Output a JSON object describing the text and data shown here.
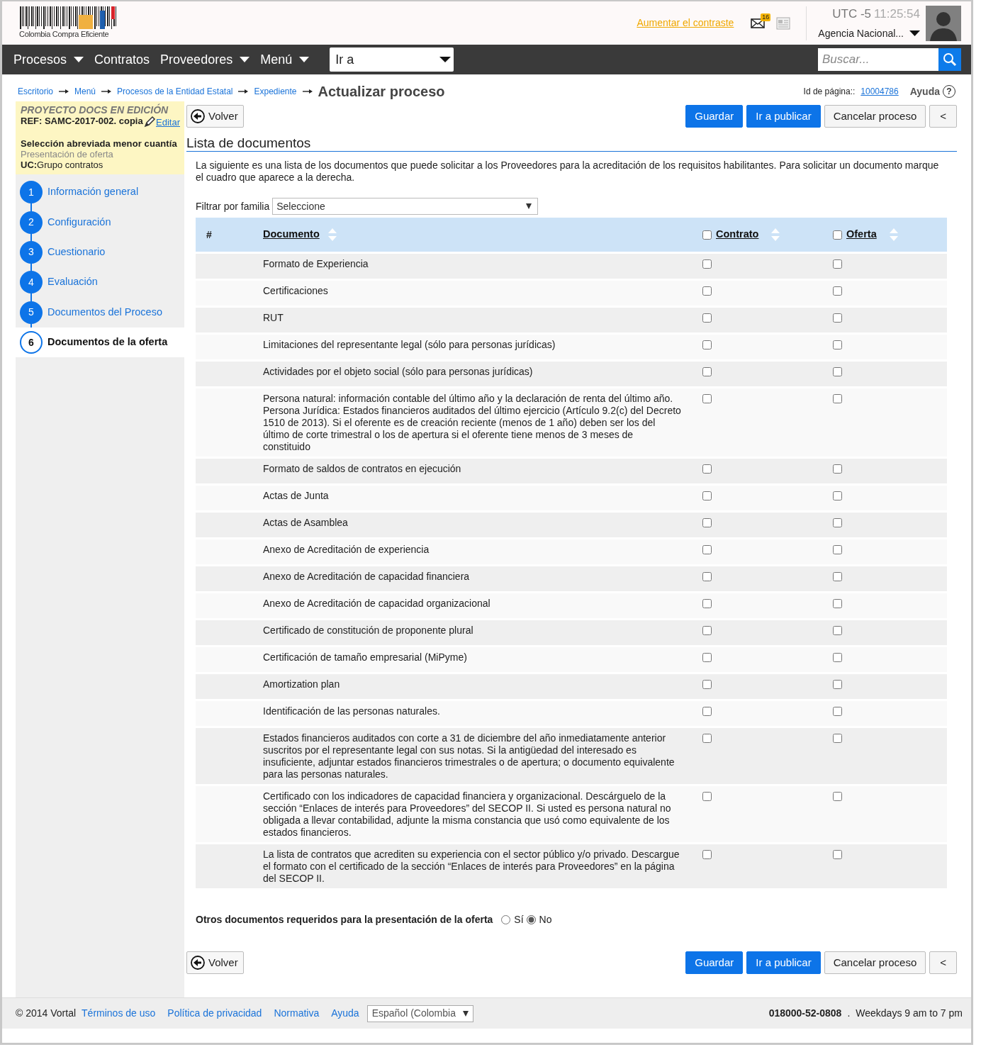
{
  "header": {
    "logo_text": "Colombia Compra Eficiente",
    "contrast_link": "Aumentar el contraste",
    "mail_count": "16",
    "timezone": "UTC -5",
    "time": "11:25:54",
    "agency": "Agencia Nacional..."
  },
  "nav": {
    "items": [
      {
        "label": "Procesos",
        "dropdown": true
      },
      {
        "label": "Contratos",
        "dropdown": false
      },
      {
        "label": "Proveedores",
        "dropdown": true
      },
      {
        "label": "Menú",
        "dropdown": true
      }
    ],
    "goto": "Ir a",
    "search_placeholder": "Buscar..."
  },
  "breadcrumb": {
    "links": [
      "Escritorio",
      "Menú",
      "Procesos de la Entidad Estatal",
      "Expediente"
    ],
    "current": "Actualizar proceso"
  },
  "page_id_label": "Id de página::",
  "page_id": "10004786",
  "help": "Ayuda",
  "help_glyph": "?",
  "sidebar": {
    "status": "PROYECTO DOCS EN EDICIÓN",
    "ref": "REF:  SAMC-2017-002. copia",
    "edit": "Editar",
    "modality": "Selección abreviada menor cuantía",
    "phase": "Presentación de oferta",
    "unit_label": "UC:",
    "unit": "Grupo contratos",
    "steps": [
      {
        "number": "1",
        "label": "Información general",
        "selected": false
      },
      {
        "number": "2",
        "label": "Configuración",
        "selected": false
      },
      {
        "number": "3",
        "label": "Cuestionario",
        "selected": false
      },
      {
        "number": "4",
        "label": "Evaluación",
        "selected": false
      },
      {
        "number": "5",
        "label": "Documentos del Proceso",
        "selected": false
      },
      {
        "number": "6",
        "label": "Documentos de la oferta",
        "selected": true
      }
    ]
  },
  "toolbar_top": {
    "back": "Volver",
    "actions": [
      {
        "label": "Guardar",
        "kind": "primary"
      },
      {
        "label": "Ir a publicar",
        "kind": "primary"
      },
      {
        "label": "Cancelar proceso",
        "kind": "secondary"
      },
      {
        "label": "<",
        "kind": "secondary"
      }
    ]
  },
  "section_title": "Lista de documentos",
  "intro": "La siguiente es una lista de los documentos que puede solicitar a los Proveedores para la acreditación de los requisitos habilitantes. Para solicitar un documento marque el cuadro que aparece a la derecha.",
  "filter": {
    "label": "Filtrar por familia",
    "value": "Seleccione"
  },
  "table": {
    "columns": [
      {
        "label": "#",
        "kind": "plain"
      },
      {
        "label": "Documento",
        "kind": "sort"
      },
      {
        "label": "Contrato",
        "kind": "sort_check",
        "checked": false
      },
      {
        "label": "Oferta",
        "kind": "sort_check",
        "checked": false
      }
    ],
    "rows": [
      {
        "document": "Formato de Experiencia",
        "contrato": false,
        "oferta": false
      },
      {
        "document": "Certificaciones",
        "contrato": false,
        "oferta": false
      },
      {
        "document": "RUT",
        "contrato": false,
        "oferta": false
      },
      {
        "document": "Limitaciones del representante legal (sólo para personas jurídicas)",
        "contrato": false,
        "oferta": false
      },
      {
        "document": "Actividades por el objeto social (sólo para personas jurídicas)",
        "contrato": false,
        "oferta": false
      },
      {
        "document": "Persona natural: información contable del último año y la declaración de renta del último año. Persona Jurídica: Estados financieros auditados del último ejercicio (Artículo 9.2(c) del Decreto 1510 de 2013). Si el oferente es de creación reciente (menos de 1 año) deben ser los del último de corte trimestral o los de apertura si el oferente tiene menos de 3 meses de constituido",
        "contrato": false,
        "oferta": false
      },
      {
        "document": "Formato de saldos de contratos en ejecución",
        "contrato": false,
        "oferta": false
      },
      {
        "document": "Actas de Junta",
        "contrato": false,
        "oferta": false
      },
      {
        "document": "Actas de Asamblea",
        "contrato": false,
        "oferta": false
      },
      {
        "document": "Anexo de Acreditación de experiencia",
        "contrato": false,
        "oferta": false
      },
      {
        "document": "Anexo de Acreditación de capacidad financiera",
        "contrato": false,
        "oferta": false
      },
      {
        "document": "Anexo de Acreditación de capacidad organizacional",
        "contrato": false,
        "oferta": false
      },
      {
        "document": "Certificado de constitución de proponente plural",
        "contrato": false,
        "oferta": false
      },
      {
        "document": "Certificación de tamaño empresarial (MiPyme)",
        "contrato": false,
        "oferta": false
      },
      {
        "document": "Amortization plan",
        "contrato": false,
        "oferta": false
      },
      {
        "document": "Identificación de las personas naturales.",
        "contrato": false,
        "oferta": false
      },
      {
        "document": "Estados financieros auditados con corte a 31 de diciembre del año inmediatamente anterior suscritos por el representante legal con sus notas. Si la antigüedad del interesado es insuficiente, adjuntar estados financieros trimestrales o de apertura; o documento equivalente para las personas naturales.",
        "contrato": false,
        "oferta": false
      },
      {
        "document": "Certificado con los indicadores de capacidad financiera y organizacional. Descárguelo de la sección “Enlaces de interés para Proveedores” del SECOP II. Si usted es persona natural no obligada a llevar contabilidad, adjunte la misma constancia que usó como equivalente de los estados financieros.",
        "contrato": false,
        "oferta": false
      },
      {
        "document": "La lista de contratos que acrediten su experiencia con el sector público y/o privado. Descargue el formato con el certificado de la sección “Enlaces de interés para Proveedores” en la página del SECOP II.",
        "contrato": false,
        "oferta": false
      }
    ]
  },
  "other_docs": {
    "question": "Otros documentos requeridos para la presentación de la oferta",
    "options": [
      {
        "label": "Sí",
        "selected": false
      },
      {
        "label": "No",
        "selected": true
      }
    ]
  },
  "toolbar_bottom": {
    "back": "Volver",
    "actions": [
      {
        "label": "Guardar",
        "kind": "primary"
      },
      {
        "label": "Ir a publicar",
        "kind": "primary"
      },
      {
        "label": "Cancelar proceso",
        "kind": "secondary"
      },
      {
        "label": "<",
        "kind": "secondary"
      }
    ]
  },
  "footer": {
    "copyright": "© 2014 Vortal",
    "links": [
      "Términos de uso",
      "Política de privacidad",
      "Normativa",
      "Ayuda"
    ],
    "language": "Español (Colombia",
    "phone": "018000-52-0808",
    "separator": ".",
    "hours": "Weekdays 9 am to 7 pm"
  }
}
